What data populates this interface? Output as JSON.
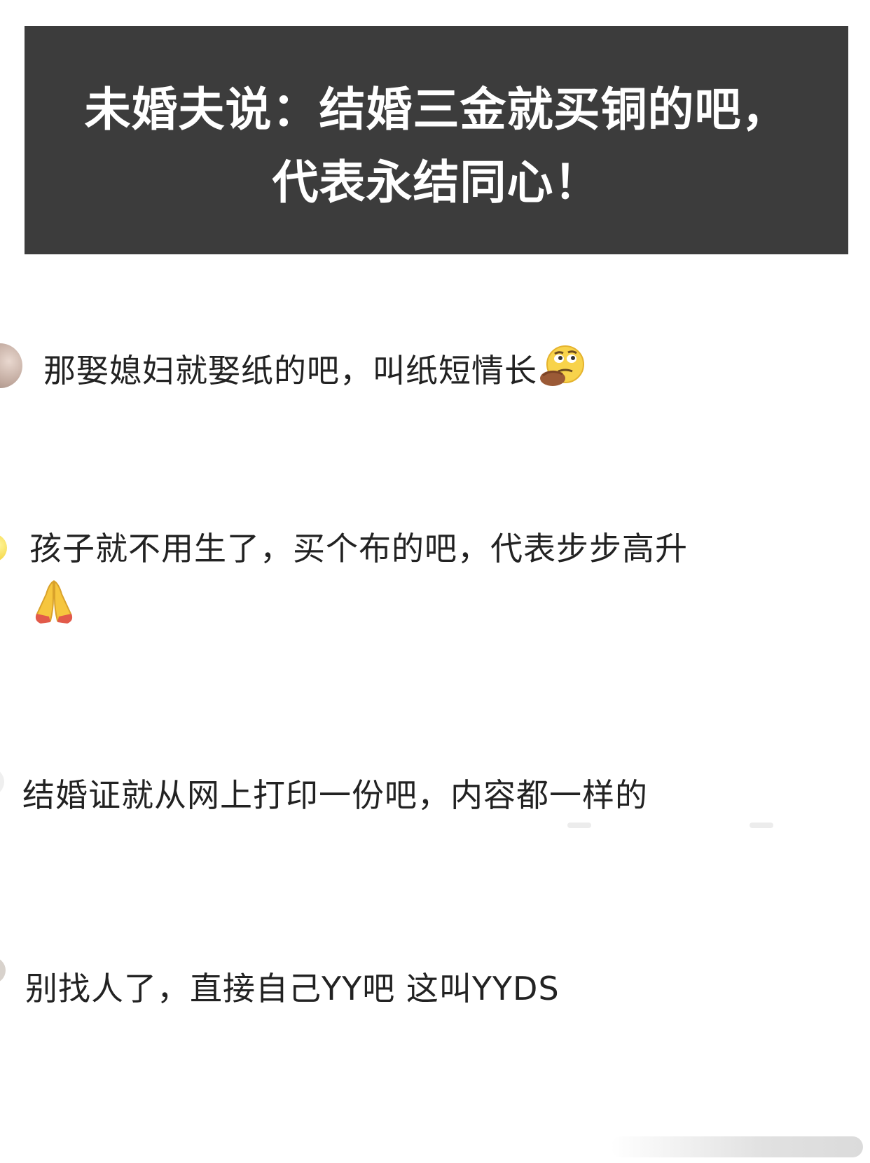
{
  "banner": {
    "line1": "未婚夫说：结婚三金就买铜的吧，",
    "line2": "代表永结同心！"
  },
  "comments": [
    {
      "text": "那娶媳妇就娶纸的吧，叫纸短情长",
      "emoji": "thinking-face-hand-icon"
    },
    {
      "text": "孩子就不用生了，买个布的吧，代表步步高升",
      "emoji": "folded-hands-icon"
    },
    {
      "text": "结婚证就从网上打印一份吧，内容都一样的"
    },
    {
      "text": "别找人了，直接自己YY吧 这叫YYDS"
    }
  ],
  "colors": {
    "banner_bg": "#3c3c3c",
    "banner_text": "#ffffff",
    "comment_text": "#222222",
    "page_bg": "#ffffff"
  }
}
